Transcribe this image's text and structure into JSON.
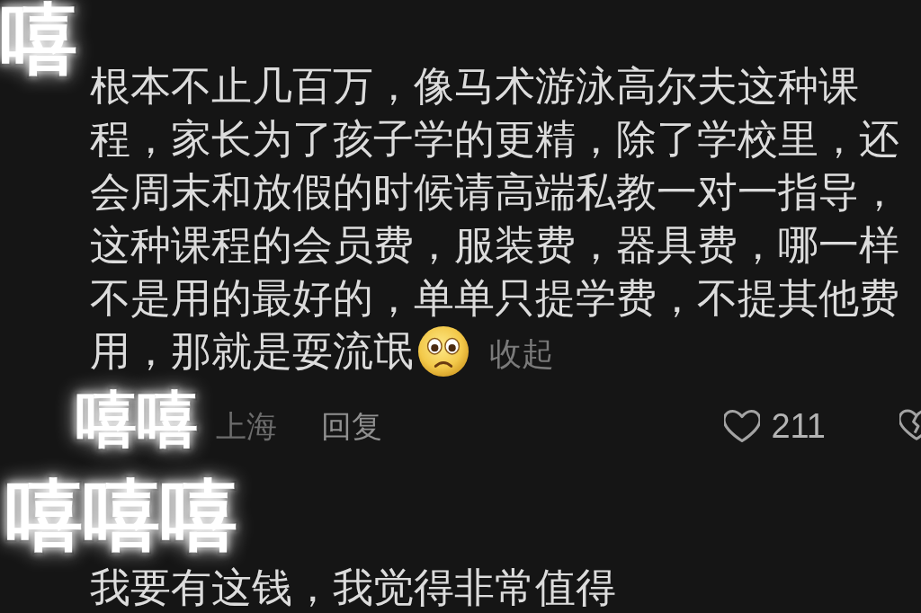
{
  "comments": [
    {
      "sticker": "嘻",
      "text": "根本不止几百万，像马术游泳高尔夫这种课程，家长为了孩子学的更精，除了学校里，还会周末和放假的时候请高端私教一对一指导，这种课程的会员费，服装费，器具费，哪一样不是用的最好的，单单只提学费，不提其他费用，那就是耍流氓",
      "collapse": "收起",
      "meta": {
        "sticker": "嘻嘻",
        "location": "上海",
        "reply": "回复",
        "liked": false,
        "likes": "211"
      }
    },
    {
      "sticker": "嘻嘻嘻",
      "text": "我要有这钱，我觉得非常值得"
    }
  ]
}
